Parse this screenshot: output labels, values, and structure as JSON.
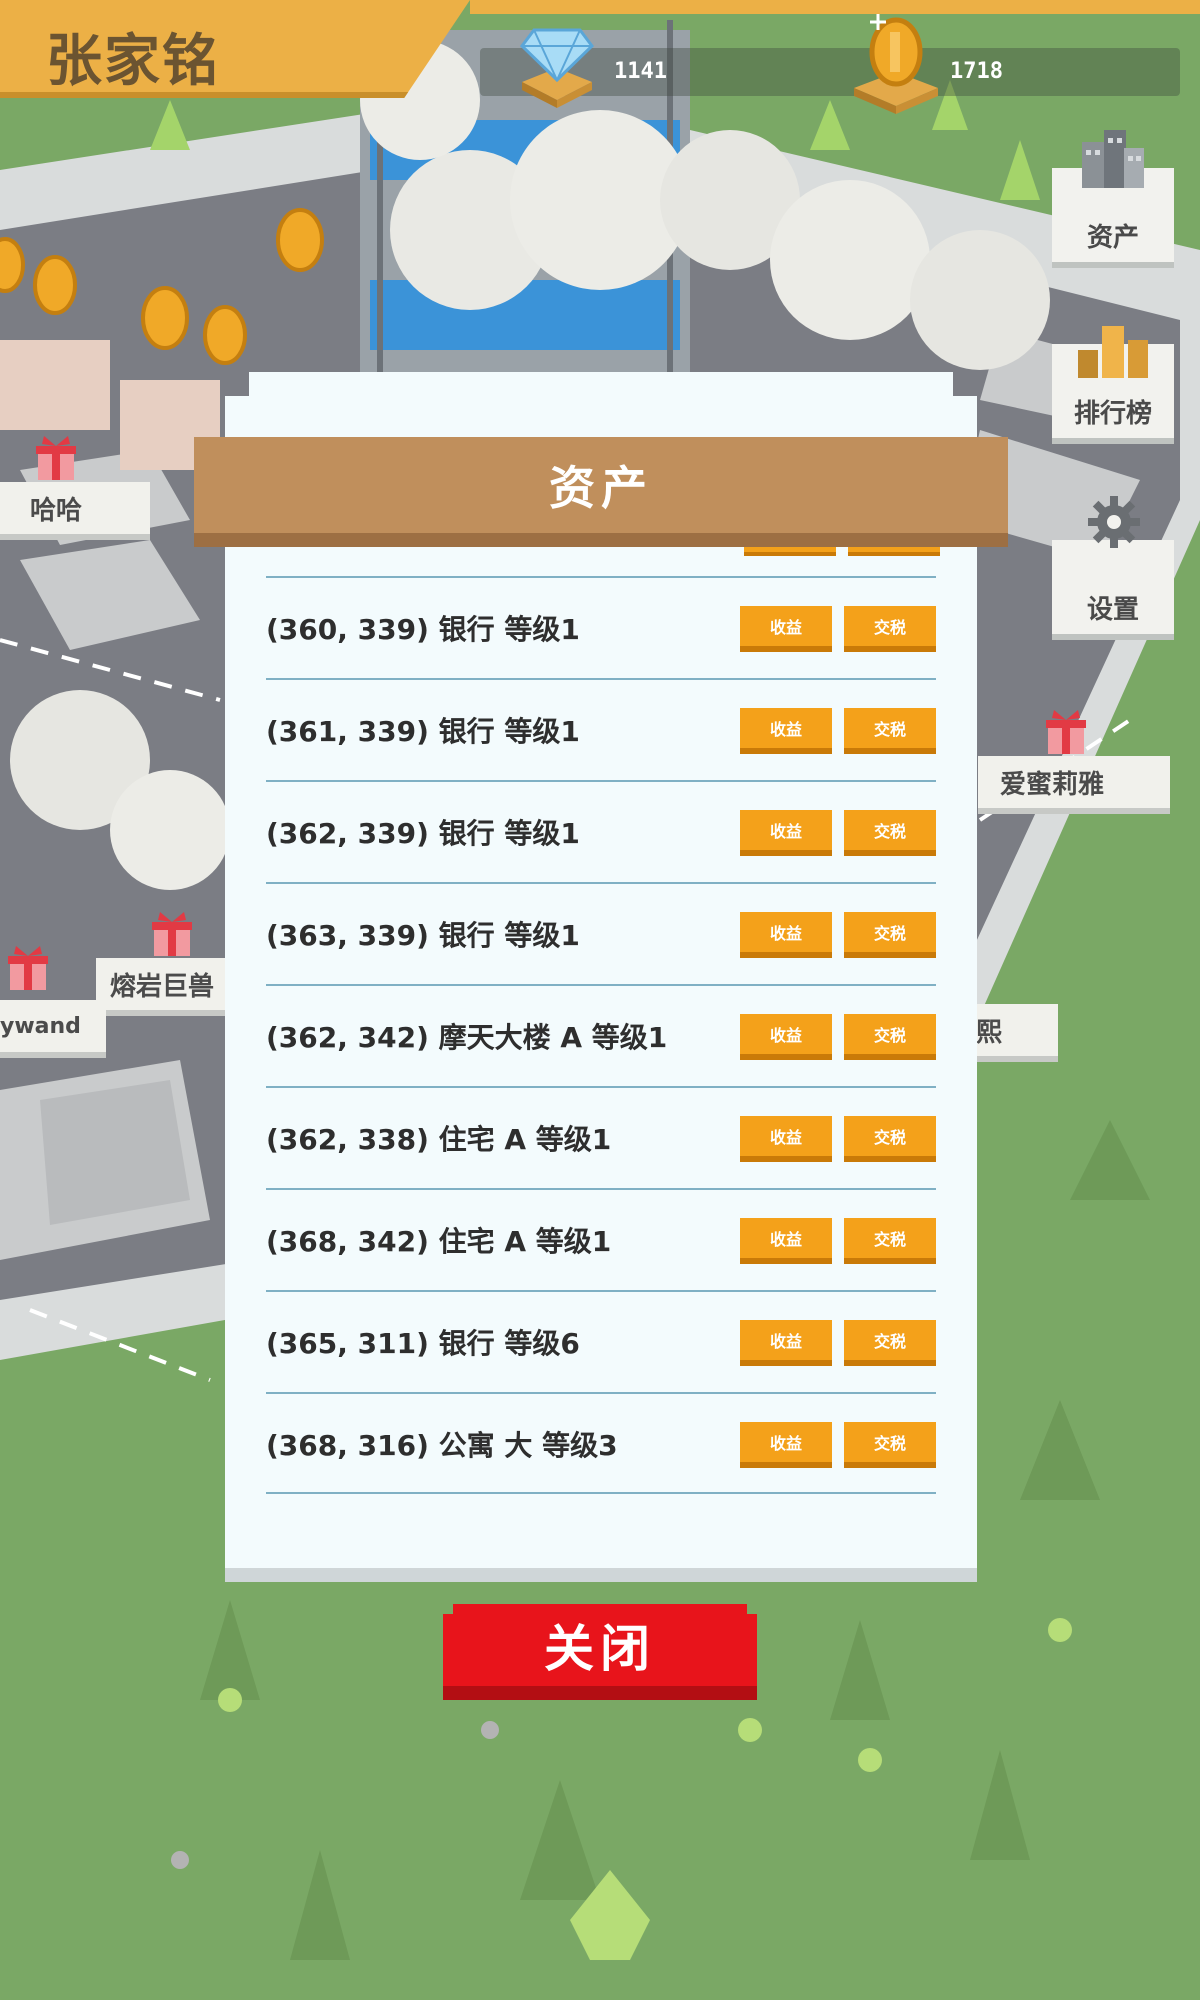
{
  "hud": {
    "player_name": "张家铭",
    "diamonds": "1141",
    "coins": "1718"
  },
  "side_menu": {
    "assets_label": "资产",
    "leaderboard_label": "排行榜",
    "settings_label": "设置"
  },
  "map_players": [
    "哈哈",
    "爱蜜莉雅",
    "熔岩巨兽",
    "ywand",
    "熙"
  ],
  "modal": {
    "title": "资产",
    "income_label": "收益",
    "tax_label": "交税",
    "rows": [
      {
        "text": "(360, 339) 银行 等级1"
      },
      {
        "text": "(361, 339) 银行 等级1"
      },
      {
        "text": "(362, 339) 银行 等级1"
      },
      {
        "text": "(363, 339) 银行 等级1"
      },
      {
        "text": "(362, 342) 摩天大楼 A 等级1"
      },
      {
        "text": "(362, 338) 住宅 A 等级1"
      },
      {
        "text": "(368, 342) 住宅 A 等级1"
      },
      {
        "text": "(365, 311) 银行 等级6"
      },
      {
        "text": "(368, 316) 公寓 大 等级3"
      }
    ],
    "close_label": "关闭"
  },
  "colors": {
    "grass": "#7aa865",
    "banner": "#ecb046",
    "modal_bg": "#f3fbfd",
    "header": "#c08f5c",
    "action_button": "#f4a11a",
    "close_button": "#e8141b"
  }
}
